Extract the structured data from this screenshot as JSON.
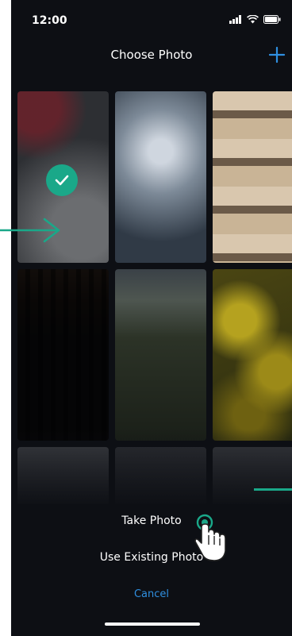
{
  "status_bar": {
    "time": "12:00"
  },
  "header": {
    "title": "Choose Photo"
  },
  "photos": [
    {
      "selected": true
    },
    {
      "selected": false
    },
    {
      "selected": false
    },
    {
      "selected": false
    },
    {
      "selected": false
    },
    {
      "selected": false
    },
    {
      "selected": false
    },
    {
      "selected": false
    },
    {
      "selected": false
    }
  ],
  "sheet": {
    "take_photo": "Take Photo",
    "use_existing": "Use Existing Photo",
    "cancel": "Cancel"
  },
  "colors": {
    "accent": "#1aa889",
    "link": "#2f8fe0",
    "background": "#0d0f14"
  },
  "icons": [
    "plus-icon",
    "check-icon",
    "arrow-right-icon",
    "hand-pointer-icon",
    "signal-icon",
    "wifi-icon",
    "battery-icon"
  ]
}
